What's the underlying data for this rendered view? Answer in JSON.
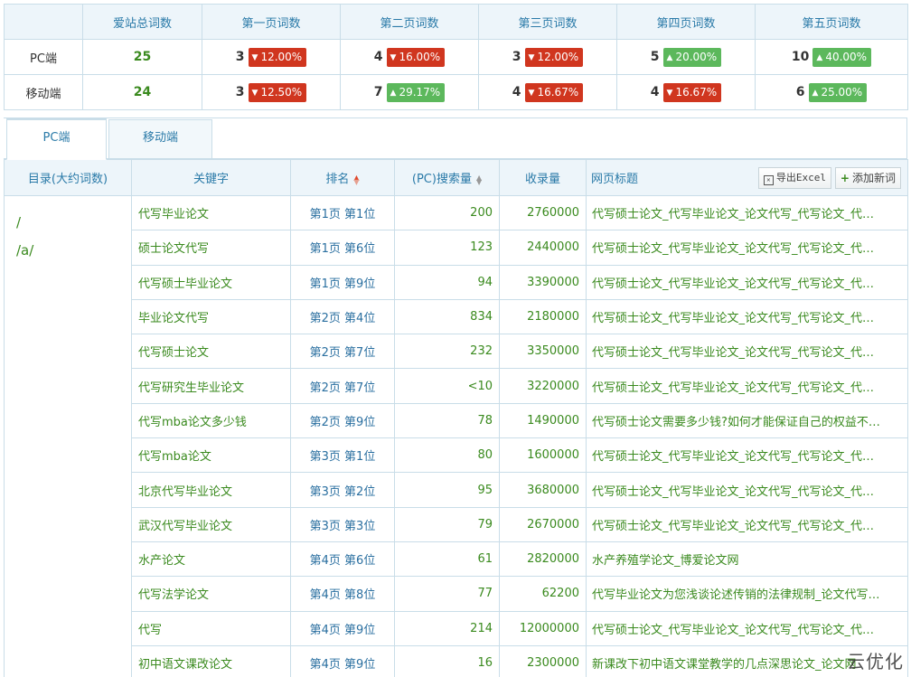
{
  "summary": {
    "headers": [
      "",
      "爱站总词数",
      "第一页词数",
      "第二页词数",
      "第三页词数",
      "第四页词数",
      "第五页词数"
    ],
    "rows": [
      {
        "label": "PC端",
        "total": "25",
        "pages": [
          {
            "count": "3",
            "pct": "12.00%",
            "dir": "down"
          },
          {
            "count": "4",
            "pct": "16.00%",
            "dir": "down"
          },
          {
            "count": "3",
            "pct": "12.00%",
            "dir": "down"
          },
          {
            "count": "5",
            "pct": "20.00%",
            "dir": "up"
          },
          {
            "count": "10",
            "pct": "40.00%",
            "dir": "up"
          }
        ]
      },
      {
        "label": "移动端",
        "total": "24",
        "pages": [
          {
            "count": "3",
            "pct": "12.50%",
            "dir": "down"
          },
          {
            "count": "7",
            "pct": "29.17%",
            "dir": "up"
          },
          {
            "count": "4",
            "pct": "16.67%",
            "dir": "down"
          },
          {
            "count": "4",
            "pct": "16.67%",
            "dir": "down"
          },
          {
            "count": "6",
            "pct": "25.00%",
            "dir": "up"
          }
        ]
      }
    ]
  },
  "tabs": [
    {
      "label": "PC端",
      "active": true
    },
    {
      "label": "移动端",
      "active": false
    }
  ],
  "table": {
    "headers": {
      "dir": "目录(大约词数)",
      "keyword": "关键字",
      "rank": "排名",
      "volume": "(PC)搜索量",
      "indexed": "收录量",
      "title": "网页标题"
    },
    "buttons": {
      "export": "导出Excel",
      "add": "添加新词"
    },
    "directories": [
      "/",
      "/a/"
    ],
    "rows": [
      {
        "keyword": "代写毕业论文",
        "rank": "第1页 第1位",
        "volume": "200",
        "indexed": "2760000",
        "title": "代写硕士论文_代写毕业论文_论文代写_代写论文_代写论文网"
      },
      {
        "keyword": "硕士论文代写",
        "rank": "第1页 第6位",
        "volume": "123",
        "indexed": "2440000",
        "title": "代写硕士论文_代写毕业论文_论文代写_代写论文_代写论文网"
      },
      {
        "keyword": "代写硕士毕业论文",
        "rank": "第1页 第9位",
        "volume": "94",
        "indexed": "3390000",
        "title": "代写硕士论文_代写毕业论文_论文代写_代写论文_代写论文网"
      },
      {
        "keyword": "毕业论文代写",
        "rank": "第2页 第4位",
        "volume": "834",
        "indexed": "2180000",
        "title": "代写硕士论文_代写毕业论文_论文代写_代写论文_代写论文网"
      },
      {
        "keyword": "代写硕士论文",
        "rank": "第2页 第7位",
        "volume": "232",
        "indexed": "3350000",
        "title": "代写硕士论文_代写毕业论文_论文代写_代写论文_代写论文网"
      },
      {
        "keyword": "代写研究生毕业论文",
        "rank": "第2页 第7位",
        "volume": "<10",
        "indexed": "3220000",
        "title": "代写硕士论文_代写毕业论文_论文代写_代写论文_代写论文网"
      },
      {
        "keyword": "代写mba论文多少钱",
        "rank": "第2页 第9位",
        "volume": "78",
        "indexed": "1490000",
        "title": "代写硕士论文需要多少钱?如何才能保证自己的权益不受侵害"
      },
      {
        "keyword": "代写mba论文",
        "rank": "第3页 第1位",
        "volume": "80",
        "indexed": "1600000",
        "title": "代写硕士论文_代写毕业论文_论文代写_代写论文_代写论文网"
      },
      {
        "keyword": "北京代写毕业论文",
        "rank": "第3页 第2位",
        "volume": "95",
        "indexed": "3680000",
        "title": "代写硕士论文_代写毕业论文_论文代写_代写论文_代写论文网"
      },
      {
        "keyword": "武汉代写毕业论文",
        "rank": "第3页 第3位",
        "volume": "79",
        "indexed": "2670000",
        "title": "代写硕士论文_代写毕业论文_论文代写_代写论文_代写论文网"
      },
      {
        "keyword": "水产论文",
        "rank": "第4页 第6位",
        "volume": "61",
        "indexed": "2820000",
        "title": "水产养殖学论文_博爱论文网"
      },
      {
        "keyword": "代写法学论文",
        "rank": "第4页 第8位",
        "volume": "77",
        "indexed": "62200",
        "title": "代写毕业论文为您浅谈论述传销的法律规制_论文代写_代写论文网"
      },
      {
        "keyword": "代写",
        "rank": "第4页 第9位",
        "volume": "214",
        "indexed": "12000000",
        "title": "代写硕士论文_代写毕业论文_论文代写_代写论文_代写论文网"
      },
      {
        "keyword": "初中语文课改论文",
        "rank": "第4页 第9位",
        "volume": "16",
        "indexed": "2300000",
        "title": "新课改下初中语文课堂教学的几点深思论文_论文网"
      }
    ]
  },
  "watermark": "云优化"
}
